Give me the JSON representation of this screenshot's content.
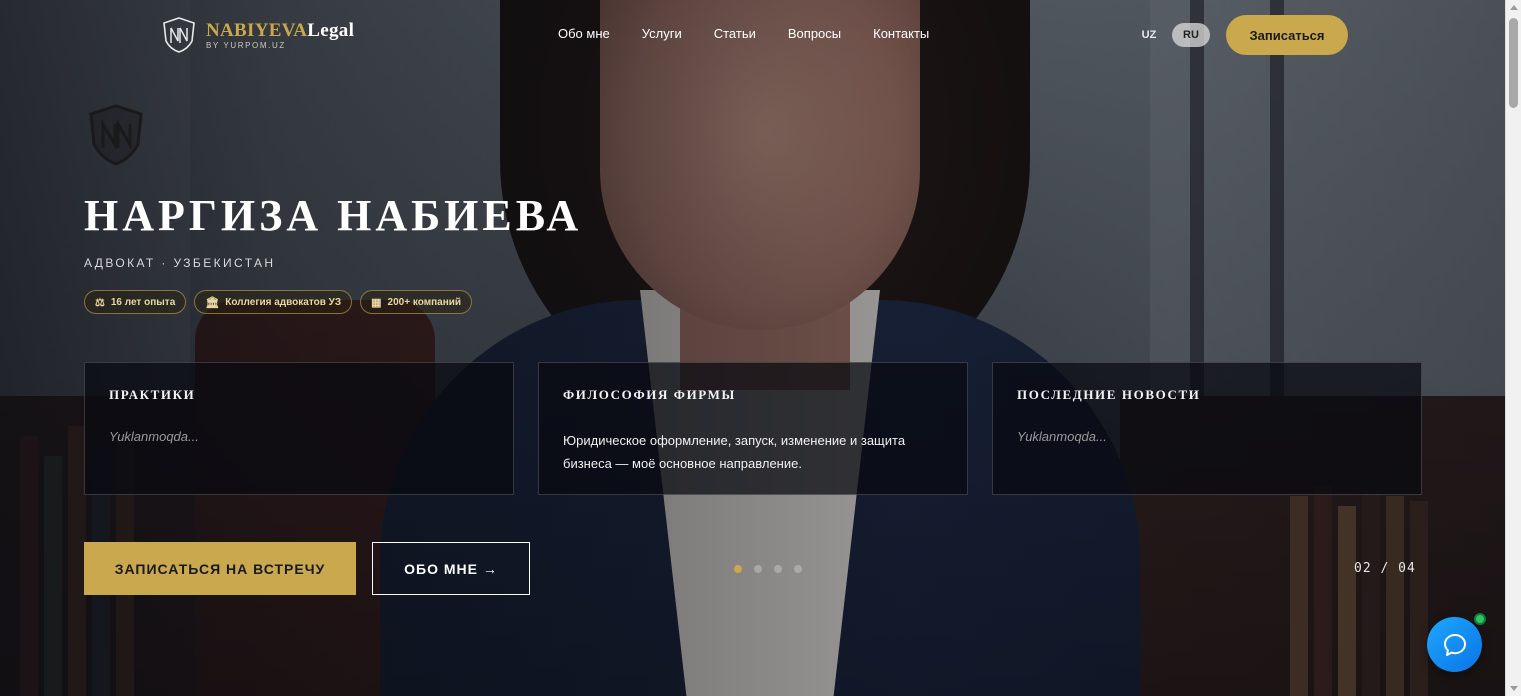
{
  "header": {
    "logo_name_gold": "NABIYEVA",
    "logo_name_white": "Legal",
    "logo_sub": "BY YURPOM.UZ",
    "nav": [
      "Обо мне",
      "Услуги",
      "Статьи",
      "Вопросы",
      "Контакты"
    ],
    "lang_uz": "UZ",
    "lang_ru": "RU",
    "active_lang": "RU",
    "cta": "Записаться"
  },
  "hero": {
    "title": "НАРГИЗА НАБИЕВА",
    "subtitle": "АДВОКАТ · УЗБЕКИСТАН",
    "badges": [
      {
        "icon": "scales-icon",
        "glyph": "⚖",
        "label": "16 лет опыта"
      },
      {
        "icon": "courthouse-icon",
        "glyph": "🏛",
        "label": "Коллегия адвокатов УЗ"
      },
      {
        "icon": "building-icon",
        "glyph": "▦",
        "label": "200+ компаний"
      }
    ]
  },
  "cards": [
    {
      "title": "ПРАКТИКИ",
      "text": "Yuklanmoqda...",
      "loading": true
    },
    {
      "title": "ФИЛОСОФИЯ ФИРМЫ",
      "text": "Юридическое оформление, запуск, изменение и защита бизнеса — моё основное направление.",
      "loading": false
    },
    {
      "title": "ПОСЛЕДНИЕ НОВОСТИ",
      "text": "Yuklanmoqda...",
      "loading": true
    }
  ],
  "actions": {
    "primary": "ЗАПИСАТЬСЯ НА ВСТРЕЧУ",
    "secondary": "ОБО МНЕ →"
  },
  "slider": {
    "total_dots": 4,
    "active_dot": 1,
    "counter": "02 / 04"
  },
  "colors": {
    "accent_gold": "#c9a84e",
    "chat_blue": "#1ea7ff",
    "online_green": "#2fc55d"
  }
}
